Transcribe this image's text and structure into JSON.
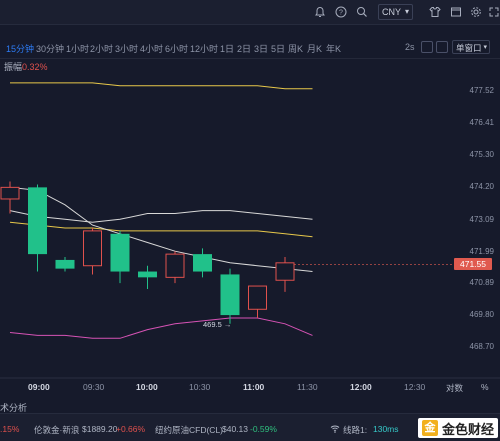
{
  "colors": {
    "up": "#e0514d",
    "down": "#21c18a",
    "ma_white": "#d8d8d8",
    "band_yellow": "#e8c84a",
    "band_pink": "#d653b5",
    "accent": "#2d7cf6"
  },
  "topbar": {
    "currency": "CNY",
    "icons": [
      "bell-icon",
      "question-icon",
      "search-icon",
      "shirt-icon",
      "window-icon",
      "gear-icon",
      "expand-icon"
    ]
  },
  "timeframes": [
    "15分钟",
    "30分钟",
    "1小时",
    "2小时",
    "3小时",
    "4小时",
    "6小时",
    "12小时",
    "1日",
    "2日",
    "3日",
    "5日",
    "周K",
    "月K",
    "年K"
  ],
  "active_timeframe": "15分钟",
  "controls": {
    "refresh": "2s",
    "indicator_window": "单窗口"
  },
  "info": {
    "label": "振幅",
    "value": "0.32%"
  },
  "yaxis": [
    "477.52",
    "476.41",
    "475.30",
    "474.20",
    "473.09",
    "471.99",
    "470.89",
    "469.80",
    "468.70"
  ],
  "current_price": "471.55",
  "low_marker": "469.5",
  "xaxis": [
    {
      "label": "09:00",
      "bold": true
    },
    {
      "label": "09:30",
      "bold": false
    },
    {
      "label": "10:00",
      "bold": true
    },
    {
      "label": "10:30",
      "bold": false
    },
    {
      "label": "11:00",
      "bold": true
    },
    {
      "label": "11:30",
      "bold": false
    },
    {
      "label": "12:00",
      "bold": true
    },
    {
      "label": "12:30",
      "bold": false
    }
  ],
  "axis_controls": {
    "pair": "对数",
    "percent": "%"
  },
  "analysis_tab": "术分析",
  "bottombar": {
    "item1_change": ".15%",
    "gold_label": "伦敦金·新浪",
    "gold_price": "$1889.20",
    "gold_change": "+0.66%",
    "oil_label": "纽约原油CFD(CL)",
    "oil_price": "$40.13",
    "oil_change": "-0.59%",
    "line_label": "线路1:",
    "latency": "130ms",
    "logo_text": "金色财经"
  },
  "chart_data": {
    "type": "candlestick",
    "ylim": [
      468.4,
      478.0
    ],
    "x": [
      "08:45",
      "09:00",
      "09:15",
      "09:30",
      "09:45",
      "10:00",
      "10:15",
      "10:30",
      "10:45",
      "11:00",
      "11:15",
      "11:30"
    ],
    "candles": [
      {
        "o": 473.8,
        "h": 474.4,
        "l": 473.3,
        "c": 474.2
      },
      {
        "o": 474.2,
        "h": 474.3,
        "l": 471.3,
        "c": 471.9
      },
      {
        "o": 471.7,
        "h": 471.8,
        "l": 471.3,
        "c": 471.4
      },
      {
        "o": 471.5,
        "h": 472.8,
        "l": 471.2,
        "c": 472.7
      },
      {
        "o": 472.6,
        "h": 472.7,
        "l": 470.9,
        "c": 471.3
      },
      {
        "o": 471.3,
        "h": 471.5,
        "l": 470.7,
        "c": 471.1
      },
      {
        "o": 471.1,
        "h": 472.0,
        "l": 470.9,
        "c": 471.9
      },
      {
        "o": 471.9,
        "h": 472.1,
        "l": 471.1,
        "c": 471.3
      },
      {
        "o": 471.2,
        "h": 471.4,
        "l": 469.5,
        "c": 469.8
      },
      {
        "o": 470.0,
        "h": 470.8,
        "l": 469.7,
        "c": 470.8
      },
      {
        "o": 471.0,
        "h": 471.8,
        "l": 470.6,
        "c": 471.6
      }
    ],
    "ma": [
      474.2,
      474.1,
      473.6,
      472.9,
      472.6,
      472.3,
      472.0,
      471.8,
      471.6,
      471.5,
      471.4,
      471.3
    ],
    "band_upper_outer": [
      477.8,
      477.8,
      477.8,
      477.8,
      477.7,
      477.7,
      477.7,
      477.7,
      477.7,
      477.7,
      477.6,
      477.6
    ],
    "band_upper_inner": [
      473.4,
      473.2,
      473.1,
      473.0,
      473.1,
      473.3,
      473.3,
      473.4,
      473.4,
      473.3,
      473.2,
      473.1
    ],
    "band_mid": [
      473.0,
      472.9,
      472.8,
      472.8,
      472.7,
      472.7,
      472.7,
      472.7,
      472.7,
      472.7,
      472.6,
      472.5
    ],
    "band_lower": [
      469.2,
      469.1,
      469.1,
      469.0,
      469.0,
      469.3,
      469.5,
      469.6,
      469.7,
      469.7,
      469.5,
      469.1
    ]
  }
}
